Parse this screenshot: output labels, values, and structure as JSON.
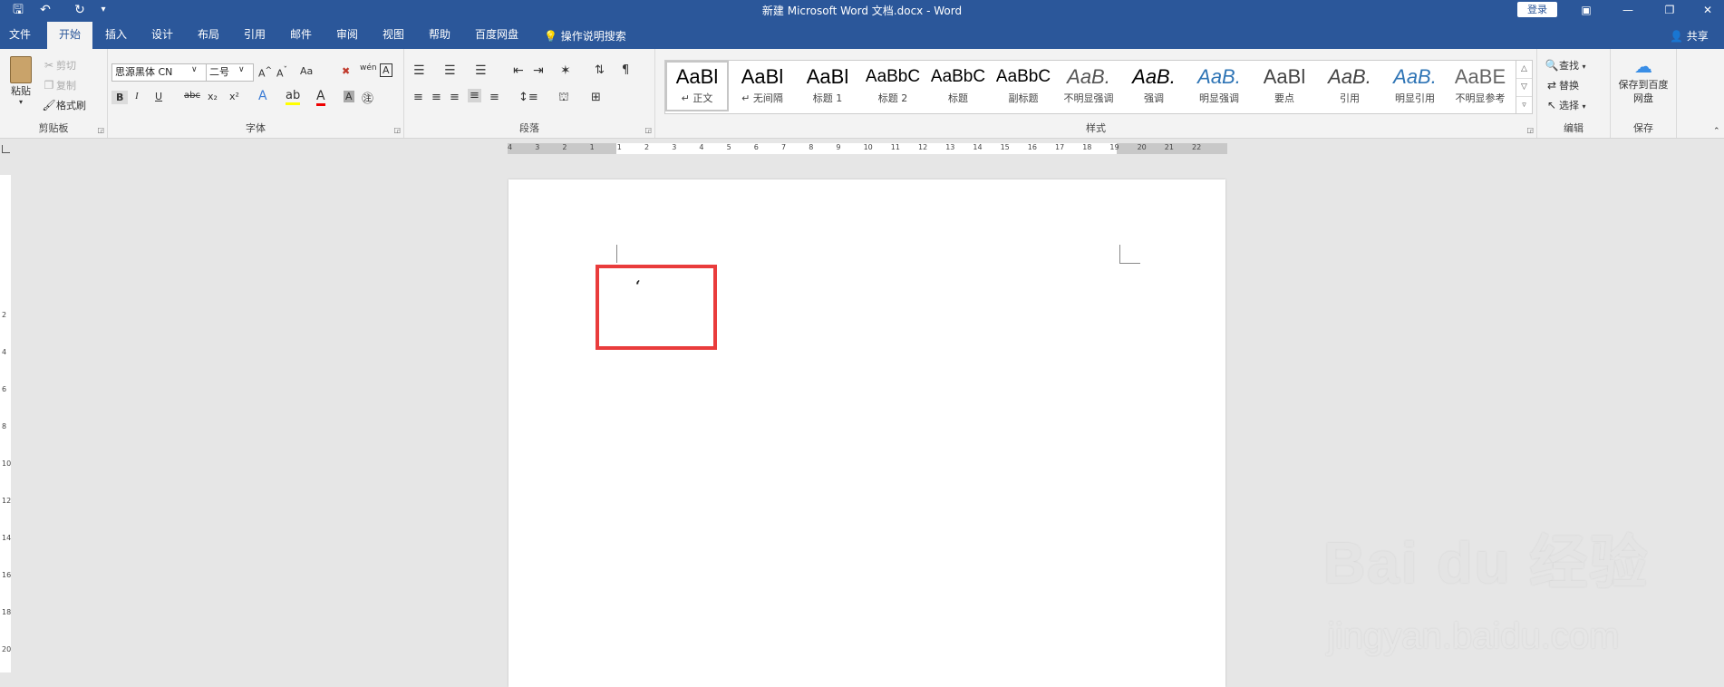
{
  "titlebar": {
    "title": "新建 Microsoft Word 文档.docx  -  Word",
    "login": "登录",
    "icons": [
      "save-icon",
      "undo-icon",
      "redo-icon",
      "customize-icon"
    ],
    "window_controls": [
      "ribbon-display-icon",
      "minimize-icon",
      "restore-icon",
      "close-icon"
    ]
  },
  "tabs": [
    "文件",
    "开始",
    "插入",
    "设计",
    "布局",
    "引用",
    "邮件",
    "审阅",
    "视图",
    "帮助",
    "百度网盘"
  ],
  "active_tab": "开始",
  "tell_me": "操作说明搜索",
  "share": "共享",
  "clipboard": {
    "paste": "粘贴",
    "cut": "剪切",
    "copy": "复制",
    "format_painter": "格式刷",
    "label": "剪贴板"
  },
  "font": {
    "family": "思源黑体 CN",
    "size": "二号",
    "label": "字体",
    "bold": "B",
    "italic": "I",
    "underline": "U",
    "strike": "abc",
    "subscript": "x₂",
    "superscript": "x²",
    "case": "Aa"
  },
  "paragraph": {
    "label": "段落"
  },
  "styles": {
    "label": "样式",
    "items": [
      {
        "sample": "AaBl",
        "name": "↵ 正文"
      },
      {
        "sample": "AaBl",
        "name": "↵ 无间隔"
      },
      {
        "sample": "AaBl",
        "name": "标题 1"
      },
      {
        "sample": "AaBbC",
        "name": "标题 2"
      },
      {
        "sample": "AaBbC",
        "name": "标题"
      },
      {
        "sample": "AaBbC",
        "name": "副标题"
      },
      {
        "sample": "AaB.",
        "name": "不明显强调"
      },
      {
        "sample": "AaB.",
        "name": "强调"
      },
      {
        "sample": "AaB.",
        "name": "明显强调"
      },
      {
        "sample": "AaBl",
        "name": "要点"
      },
      {
        "sample": "AaB.",
        "name": "引用"
      },
      {
        "sample": "AaB.",
        "name": "明显引用"
      },
      {
        "sample": "AaBE",
        "name": "不明显参考"
      }
    ]
  },
  "editing": {
    "find": "查找",
    "replace": "替换",
    "select": "选择",
    "label": "编辑"
  },
  "save_group": {
    "button": "保存到百度网盘",
    "label": "保存"
  },
  "ruler_numbers": [
    "4",
    "3",
    "2",
    "1",
    "1",
    "2",
    "3",
    "4",
    "5",
    "6",
    "7",
    "8",
    "9",
    "10",
    "11",
    "12",
    "13",
    "14",
    "15",
    "16",
    "17",
    "18",
    "19",
    "20",
    "21",
    "22"
  ],
  "vruler_numbers": [
    "2",
    "4",
    "6",
    "8",
    "10",
    "12",
    "14",
    "16",
    "18",
    "20"
  ],
  "document": {
    "content": "‘"
  },
  "watermark": {
    "logo": "Bai du 经验",
    "url": "jingyan.baidu.com"
  },
  "colors": {
    "accent": "#2b579a",
    "highlight_box": "#e93c3c"
  }
}
